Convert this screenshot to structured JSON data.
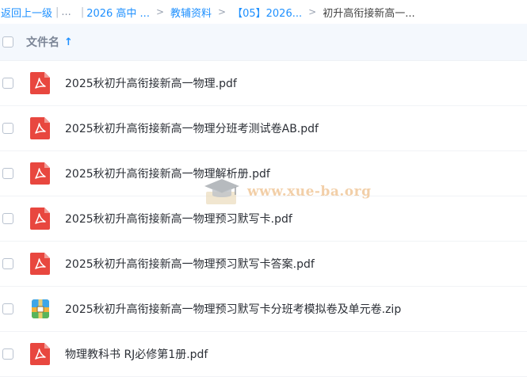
{
  "breadcrumb": {
    "back": "返回上一级",
    "pipe": "|",
    "ellipsis": "...",
    "sep": ">",
    "crumbs": [
      "2026 高中 ...",
      "教辅资料",
      "【05】2026..."
    ],
    "current": "初升高衔接新高一..."
  },
  "header": {
    "column_name": "文件名",
    "sort_icon": "arrow-up-icon"
  },
  "files": [
    {
      "name": "2025秋初升高衔接新高一物理.pdf",
      "icon": "pdf-icon"
    },
    {
      "name": "2025秋初升高衔接新高一物理分班考测试卷AB.pdf",
      "icon": "pdf-icon"
    },
    {
      "name": "2025秋初升高衔接新高一物理解析册.pdf",
      "icon": "pdf-icon"
    },
    {
      "name": "2025秋初升高衔接新高一物理预习默写卡.pdf",
      "icon": "pdf-icon"
    },
    {
      "name": "2025秋初升高衔接新高一物理预习默写卡答案.pdf",
      "icon": "pdf-icon"
    },
    {
      "name": "2025秋初升高衔接新高一物理预习默写卡分班考模拟卷及单元卷.zip",
      "icon": "zip-icon"
    },
    {
      "name": "物理教科书 RJ必修第1册.pdf",
      "icon": "pdf-icon"
    }
  ],
  "watermark": {
    "text": "www.xue-ba.org"
  },
  "colors": {
    "link": "#1e90ff",
    "pdf": "#e8473f",
    "header_bg": "#f4f8fd"
  }
}
